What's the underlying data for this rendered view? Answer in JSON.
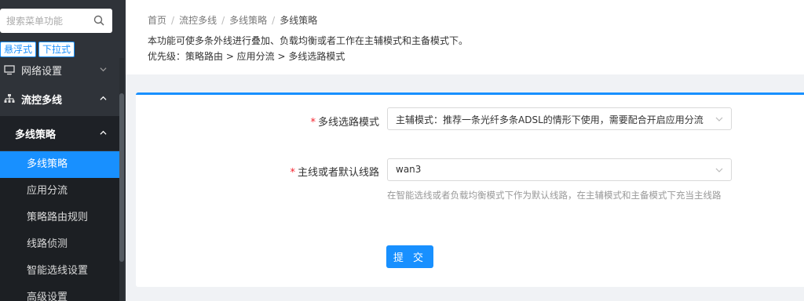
{
  "sidebar": {
    "search": {
      "placeholder": "搜索菜单功能"
    },
    "mode_toggles": [
      "悬浮式",
      "下拉式"
    ],
    "groups": [
      {
        "label": "网络设置",
        "icon": "monitor-icon",
        "expanded": false
      },
      {
        "label": "流控多线",
        "icon": "network-icon",
        "expanded": true
      }
    ],
    "subgroup": {
      "label": "多线策略",
      "expanded": true
    },
    "items": [
      {
        "label": "多线策略",
        "active": true
      },
      {
        "label": "应用分流",
        "active": false
      },
      {
        "label": "策略路由规则",
        "active": false
      },
      {
        "label": "线路侦测",
        "active": false
      },
      {
        "label": "智能选线设置",
        "active": false
      },
      {
        "label": "高级设置",
        "active": false
      }
    ]
  },
  "breadcrumb": [
    "首页",
    "流控多线",
    "多线策略",
    "多线策略"
  ],
  "header": {
    "description": "本功能可使多条外线进行叠加、负载均衡或者工作在主辅模式和主备模式下。",
    "priority": "优先级：策略路由 > 应用分流 > 多线选路模式"
  },
  "form": {
    "mode": {
      "label": "多线选路模式",
      "value": "主辅模式：推荐一条光纤多条ADSL的情形下使用，需要配合开启应用分流"
    },
    "default_line": {
      "label": "主线或者默认线路",
      "value": "wan3",
      "hint": "在智能选线或者负载均衡模式下作为默认线路，在主辅模式和主备模式下充当主线路"
    },
    "submit_label": "提 交"
  },
  "colors": {
    "accent": "#1890ff",
    "sidebar_bg": "#2f3339",
    "required": "#f5222d"
  }
}
